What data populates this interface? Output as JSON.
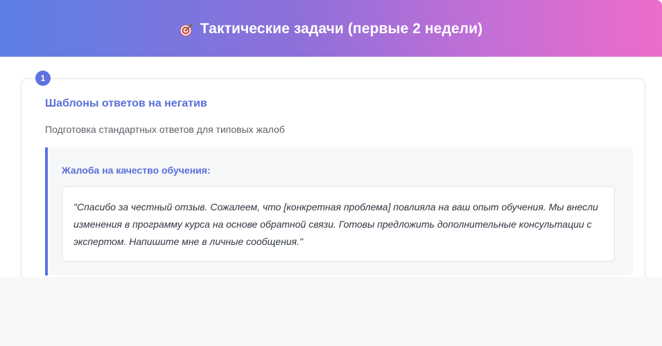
{
  "header": {
    "title": "Тактические задачи (первые 2 недели)",
    "icon": "target-icon"
  },
  "task": {
    "number": "1",
    "title": "Шаблоны ответов на негатив",
    "description": "Подготовка стандартных ответов для типовых жалоб",
    "template": {
      "title": "Жалоба на качество обучения:",
      "text": "\"Спасибо за честный отзыв. Сожалеем, что [конкретная проблема] повлияла на ваш опыт обучения. Мы внесли изменения в программу курса на основе обратной связи. Готовы предложить дополнительные консультации с экспертом. Напишите мне в личные сообщения.\""
    }
  },
  "colors": {
    "accent": "#5a6fd9",
    "gradient_start": "#5b7fe6",
    "gradient_end": "#ec6cc9"
  }
}
